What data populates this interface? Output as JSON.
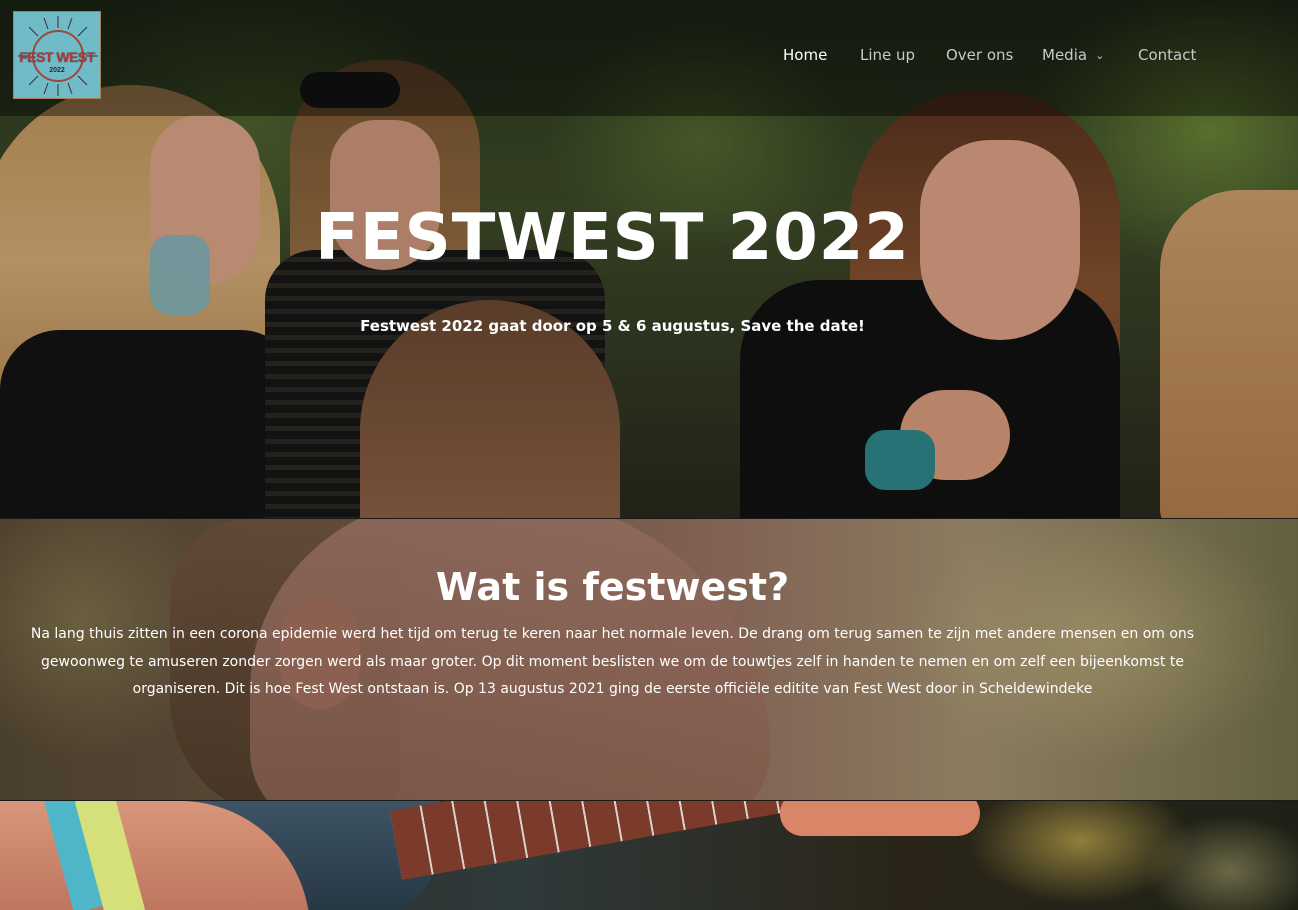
{
  "logo": {
    "brand": "FEST WEST",
    "year": "2022"
  },
  "nav": {
    "items": [
      {
        "label": "Home",
        "active": true
      },
      {
        "label": "Line up",
        "active": false
      },
      {
        "label": "Over ons",
        "active": false
      },
      {
        "label": "Media",
        "active": false,
        "has_dropdown": true
      },
      {
        "label": "Contact",
        "active": false
      }
    ]
  },
  "hero": {
    "title": "FESTWEST 2022",
    "subtitle": "Festwest 2022 gaat door op 5 & 6 augustus, Save the date!"
  },
  "about": {
    "title": "Wat is festwest?",
    "body": "Na lang thuis zitten in een corona epidemie werd het tijd om terug te keren naar het normale leven. De drang om terug samen te zijn met andere mensen en om ons gewoonweg te amuseren zonder zorgen werd als maar groter. Op dit moment beslisten we om de touwtjes zelf in handen te nemen en om zelf een bijeenkomst te organiseren. Dit is hoe Fest West ontstaan is. Op 13 augustus 2021 ging de eerste officiële editite van Fest West door in Scheldewindeke"
  },
  "colors": {
    "nav_active": "#ffffff",
    "nav_inactive": "#c9c9c9",
    "logo_bg": "#6fbcc8",
    "logo_text": "#b13a3a"
  }
}
